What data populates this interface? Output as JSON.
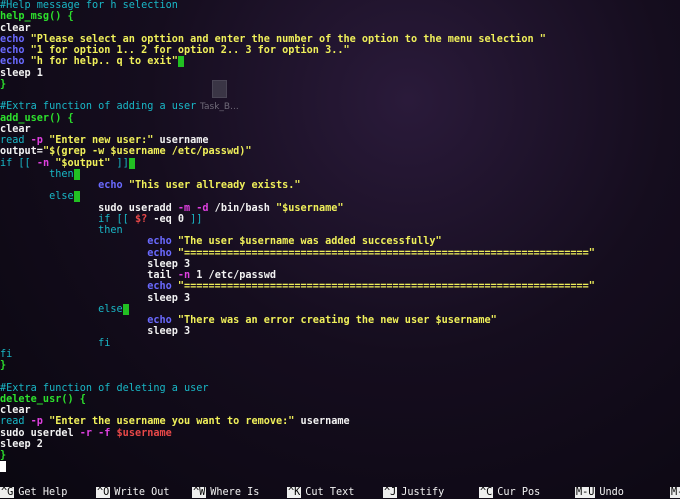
{
  "editor": {
    "lines": [
      [
        {
          "t": "#Help message for h selection",
          "c": "comment"
        }
      ],
      [
        {
          "t": "help_msg",
          "c": "func"
        },
        {
          "t": "() {",
          "c": "brace"
        }
      ],
      [
        {
          "t": "clear",
          "c": "plain"
        }
      ],
      [
        {
          "t": "echo ",
          "c": "echo"
        },
        {
          "t": "\"Please select an opttion and enter the number of the option to the menu selection \"",
          "c": "str"
        }
      ],
      [
        {
          "t": "echo ",
          "c": "echo"
        },
        {
          "t": "\"1 for option 1.. 2 for option 2.. 3 for option 3..\"",
          "c": "str"
        }
      ],
      [
        {
          "t": "echo ",
          "c": "echo"
        },
        {
          "t": "\"h for help.. q to exit\"",
          "c": "str"
        },
        {
          "t": "",
          "c": "cursor"
        }
      ],
      [
        {
          "t": "sleep 1",
          "c": "plain"
        }
      ],
      [
        {
          "t": "}",
          "c": "brace"
        }
      ],
      [],
      [
        {
          "t": "#Extra function of adding a user",
          "c": "comment"
        }
      ],
      [
        {
          "t": "add_user",
          "c": "func"
        },
        {
          "t": "() {",
          "c": "brace"
        }
      ],
      [
        {
          "t": "clear",
          "c": "plain"
        }
      ],
      [
        {
          "t": "read ",
          "c": "kw"
        },
        {
          "t": "-p ",
          "c": "flag"
        },
        {
          "t": "\"Enter new user:\"",
          "c": "str"
        },
        {
          "t": " username",
          "c": "plain"
        }
      ],
      [
        {
          "t": "output=",
          "c": "plain"
        },
        {
          "t": "\"$(grep -w $username /etc/passwd)\"",
          "c": "str"
        }
      ],
      [
        {
          "t": "if [[ ",
          "c": "kw"
        },
        {
          "t": "-n ",
          "c": "flag"
        },
        {
          "t": "\"$output\"",
          "c": "str"
        },
        {
          "t": " ]]",
          "c": "kw"
        },
        {
          "t": "",
          "c": "cursor"
        }
      ],
      [
        {
          "t": "        then",
          "c": "kw"
        },
        {
          "t": "",
          "c": "cursor"
        }
      ],
      [
        {
          "t": "                ",
          "c": "plain"
        },
        {
          "t": "echo ",
          "c": "echo"
        },
        {
          "t": "\"This user allready exists.\"",
          "c": "str"
        }
      ],
      [
        {
          "t": "        else",
          "c": "kw"
        },
        {
          "t": "",
          "c": "cursor"
        }
      ],
      [
        {
          "t": "                sudo useradd ",
          "c": "plain"
        },
        {
          "t": "-m -d",
          "c": "flag"
        },
        {
          "t": " /bin/bash ",
          "c": "plain"
        },
        {
          "t": "\"$username\"",
          "c": "str"
        }
      ],
      [
        {
          "t": "                if [[ ",
          "c": "kw"
        },
        {
          "t": "$?",
          "c": "var"
        },
        {
          "t": " -eq ",
          "c": "plain"
        },
        {
          "t": "0",
          "c": "plain"
        },
        {
          "t": " ]]",
          "c": "kw"
        }
      ],
      [
        {
          "t": "                then",
          "c": "kw"
        }
      ],
      [
        {
          "t": "                        ",
          "c": "plain"
        },
        {
          "t": "echo ",
          "c": "echo"
        },
        {
          "t": "\"The user $username was added successfully\"",
          "c": "str"
        }
      ],
      [
        {
          "t": "                        ",
          "c": "plain"
        },
        {
          "t": "echo ",
          "c": "echo"
        },
        {
          "t": "\"==================================================================\"",
          "c": "str"
        }
      ],
      [
        {
          "t": "                        sleep 3",
          "c": "plain"
        }
      ],
      [
        {
          "t": "                        tail ",
          "c": "plain"
        },
        {
          "t": "-n",
          "c": "flag"
        },
        {
          "t": " 1 /etc/passwd",
          "c": "plain"
        }
      ],
      [
        {
          "t": "                        ",
          "c": "plain"
        },
        {
          "t": "echo ",
          "c": "echo"
        },
        {
          "t": "\"==================================================================\"",
          "c": "str"
        }
      ],
      [
        {
          "t": "                        sleep 3",
          "c": "plain"
        }
      ],
      [
        {
          "t": "                else",
          "c": "kw"
        },
        {
          "t": "",
          "c": "cursor"
        }
      ],
      [
        {
          "t": "                        ",
          "c": "plain"
        },
        {
          "t": "echo ",
          "c": "echo"
        },
        {
          "t": "\"There was an error creating the new user $username\"",
          "c": "str"
        }
      ],
      [
        {
          "t": "                        sleep 3",
          "c": "plain"
        }
      ],
      [
        {
          "t": "                fi",
          "c": "kw"
        }
      ],
      [
        {
          "t": "fi",
          "c": "kw"
        }
      ],
      [
        {
          "t": "}",
          "c": "brace"
        }
      ],
      [],
      [
        {
          "t": "#Extra function of deleting a user",
          "c": "comment"
        }
      ],
      [
        {
          "t": "delete_usr",
          "c": "func"
        },
        {
          "t": "() {",
          "c": "brace"
        }
      ],
      [
        {
          "t": "clear",
          "c": "plain"
        }
      ],
      [
        {
          "t": "read ",
          "c": "kw"
        },
        {
          "t": "-p ",
          "c": "flag"
        },
        {
          "t": "\"Enter the username you want to remove:\"",
          "c": "str"
        },
        {
          "t": " username",
          "c": "plain"
        }
      ],
      [
        {
          "t": "sudo userdel ",
          "c": "plain"
        },
        {
          "t": "-r -f ",
          "c": "flag"
        },
        {
          "t": "$username",
          "c": "var"
        }
      ],
      [
        {
          "t": "sleep 2",
          "c": "plain"
        }
      ],
      [
        {
          "t": "}",
          "c": "brace"
        }
      ],
      [
        {
          "t": "",
          "c": "textcursor"
        }
      ]
    ]
  },
  "desktop_icon": {
    "label": "Task_B..."
  },
  "shortcuts": [
    {
      "key": "^G",
      "label": "Get Help"
    },
    {
      "key": "^O",
      "label": "Write Out"
    },
    {
      "key": "^W",
      "label": "Where Is"
    },
    {
      "key": "^K",
      "label": "Cut Text"
    },
    {
      "key": "^J",
      "label": "Justify"
    },
    {
      "key": "^C",
      "label": "Cur Pos"
    },
    {
      "key": "M-U",
      "label": "Undo"
    },
    {
      "key": "M-",
      "label": ""
    }
  ],
  "colors": {
    "comment": "#19b7c6",
    "func": "#2de02d",
    "echo": "#6a6aff",
    "string": "#f0f05a",
    "flag": "#e040e0",
    "var": "#e84848",
    "cursor": "#22c022"
  }
}
